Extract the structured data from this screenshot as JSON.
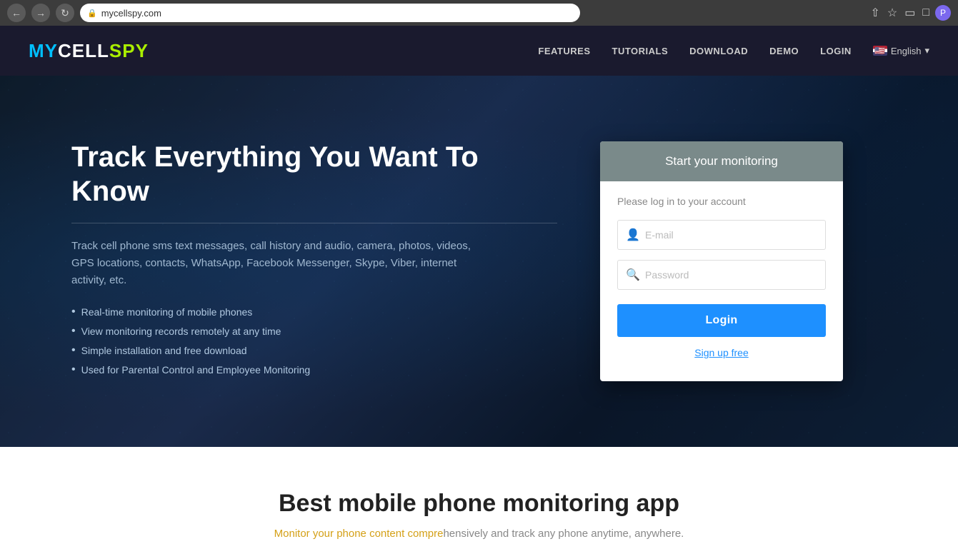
{
  "browser": {
    "url": "mycellspy.com",
    "lock_symbol": "🔒"
  },
  "navbar": {
    "logo": {
      "my": "MY",
      "cell": "CELL",
      "spy": "SPY"
    },
    "links": [
      {
        "id": "features",
        "label": "FEATURES"
      },
      {
        "id": "tutorials",
        "label": "TUTORIALS"
      },
      {
        "id": "download",
        "label": "DOWNLOAD"
      },
      {
        "id": "demo",
        "label": "DEMO"
      },
      {
        "id": "login",
        "label": "LOGIN"
      }
    ],
    "language": {
      "label": "English",
      "chevron": "▾"
    }
  },
  "hero": {
    "title": "Track Everything You Want To Know",
    "description": "Track cell phone sms text messages, call history and audio, camera, photos, videos, GPS locations, contacts, WhatsApp, Facebook Messenger, Skype, Viber, internet activity, etc.",
    "bullets": [
      "Real-time monitoring of mobile phones",
      "View monitoring records remotely at any time",
      "Simple installation and free download",
      "Used for Parental Control and Employee Monitoring"
    ]
  },
  "login_card": {
    "header": "Start your monitoring",
    "subtitle": "Please log in to your account",
    "email_placeholder": "E-mail",
    "password_placeholder": "Password",
    "login_button": "Login",
    "signup_link": "Sign up free"
  },
  "bottom": {
    "title": "Best mobile phone monitoring app",
    "subtitle_1": "Monitor your phone content compre",
    "subtitle_2": "hensively and track any phone anytime, anywhere."
  }
}
